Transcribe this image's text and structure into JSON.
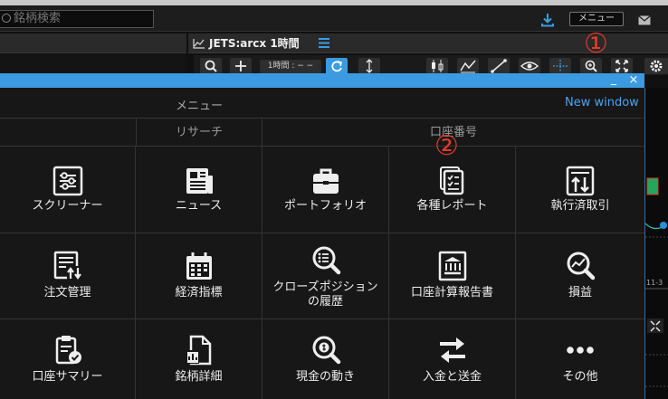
{
  "topbar": {
    "search_placeholder": "銘柄検索",
    "menu_button": "メニュー",
    "icons": [
      "download-icon",
      "mail-icon"
    ]
  },
  "chart": {
    "title": "JETS:arcx 1時間",
    "interval_label": "1時間 : − −"
  },
  "annotations": {
    "circle_1": "①",
    "circle_2": "②",
    "color": "#e23a2a"
  },
  "menu": {
    "title": "メニュー",
    "new_window": "New window",
    "minimize": "_",
    "close": "×",
    "sections": {
      "research": "リサーチ",
      "account": "口座番号"
    },
    "items": [
      {
        "label": "スクリーナー",
        "icon": "screener-sliders-icon"
      },
      {
        "label": "ニュース",
        "icon": "newspaper-icon"
      },
      {
        "label": "ポートフォリオ",
        "icon": "briefcase-icon"
      },
      {
        "label": "各種レポート",
        "icon": "reports-icon"
      },
      {
        "label": "執行済取引",
        "icon": "executed-trades-icon"
      },
      {
        "label": "注文管理",
        "icon": "order-management-icon"
      },
      {
        "label": "経済指標",
        "icon": "calendar-icon"
      },
      {
        "label": "クローズポジション\nの履歴",
        "icon": "magnifier-list-icon"
      },
      {
        "label": "口座計算報告書",
        "icon": "bank-statement-icon"
      },
      {
        "label": "損益",
        "icon": "magnifier-chart-icon"
      },
      {
        "label": "口座サマリー",
        "icon": "clipboard-check-icon"
      },
      {
        "label": "銘柄詳細",
        "icon": "document-chart-icon"
      },
      {
        "label": "現金の動き",
        "icon": "magnifier-cash-icon"
      },
      {
        "label": "入金と送金",
        "icon": "transfer-arrows-icon"
      },
      {
        "label": "その他",
        "icon": "more-dots-icon"
      }
    ]
  },
  "colors": {
    "accent_blue": "#3c9be0",
    "link_blue": "#4aa3f0",
    "background": "#171717"
  }
}
